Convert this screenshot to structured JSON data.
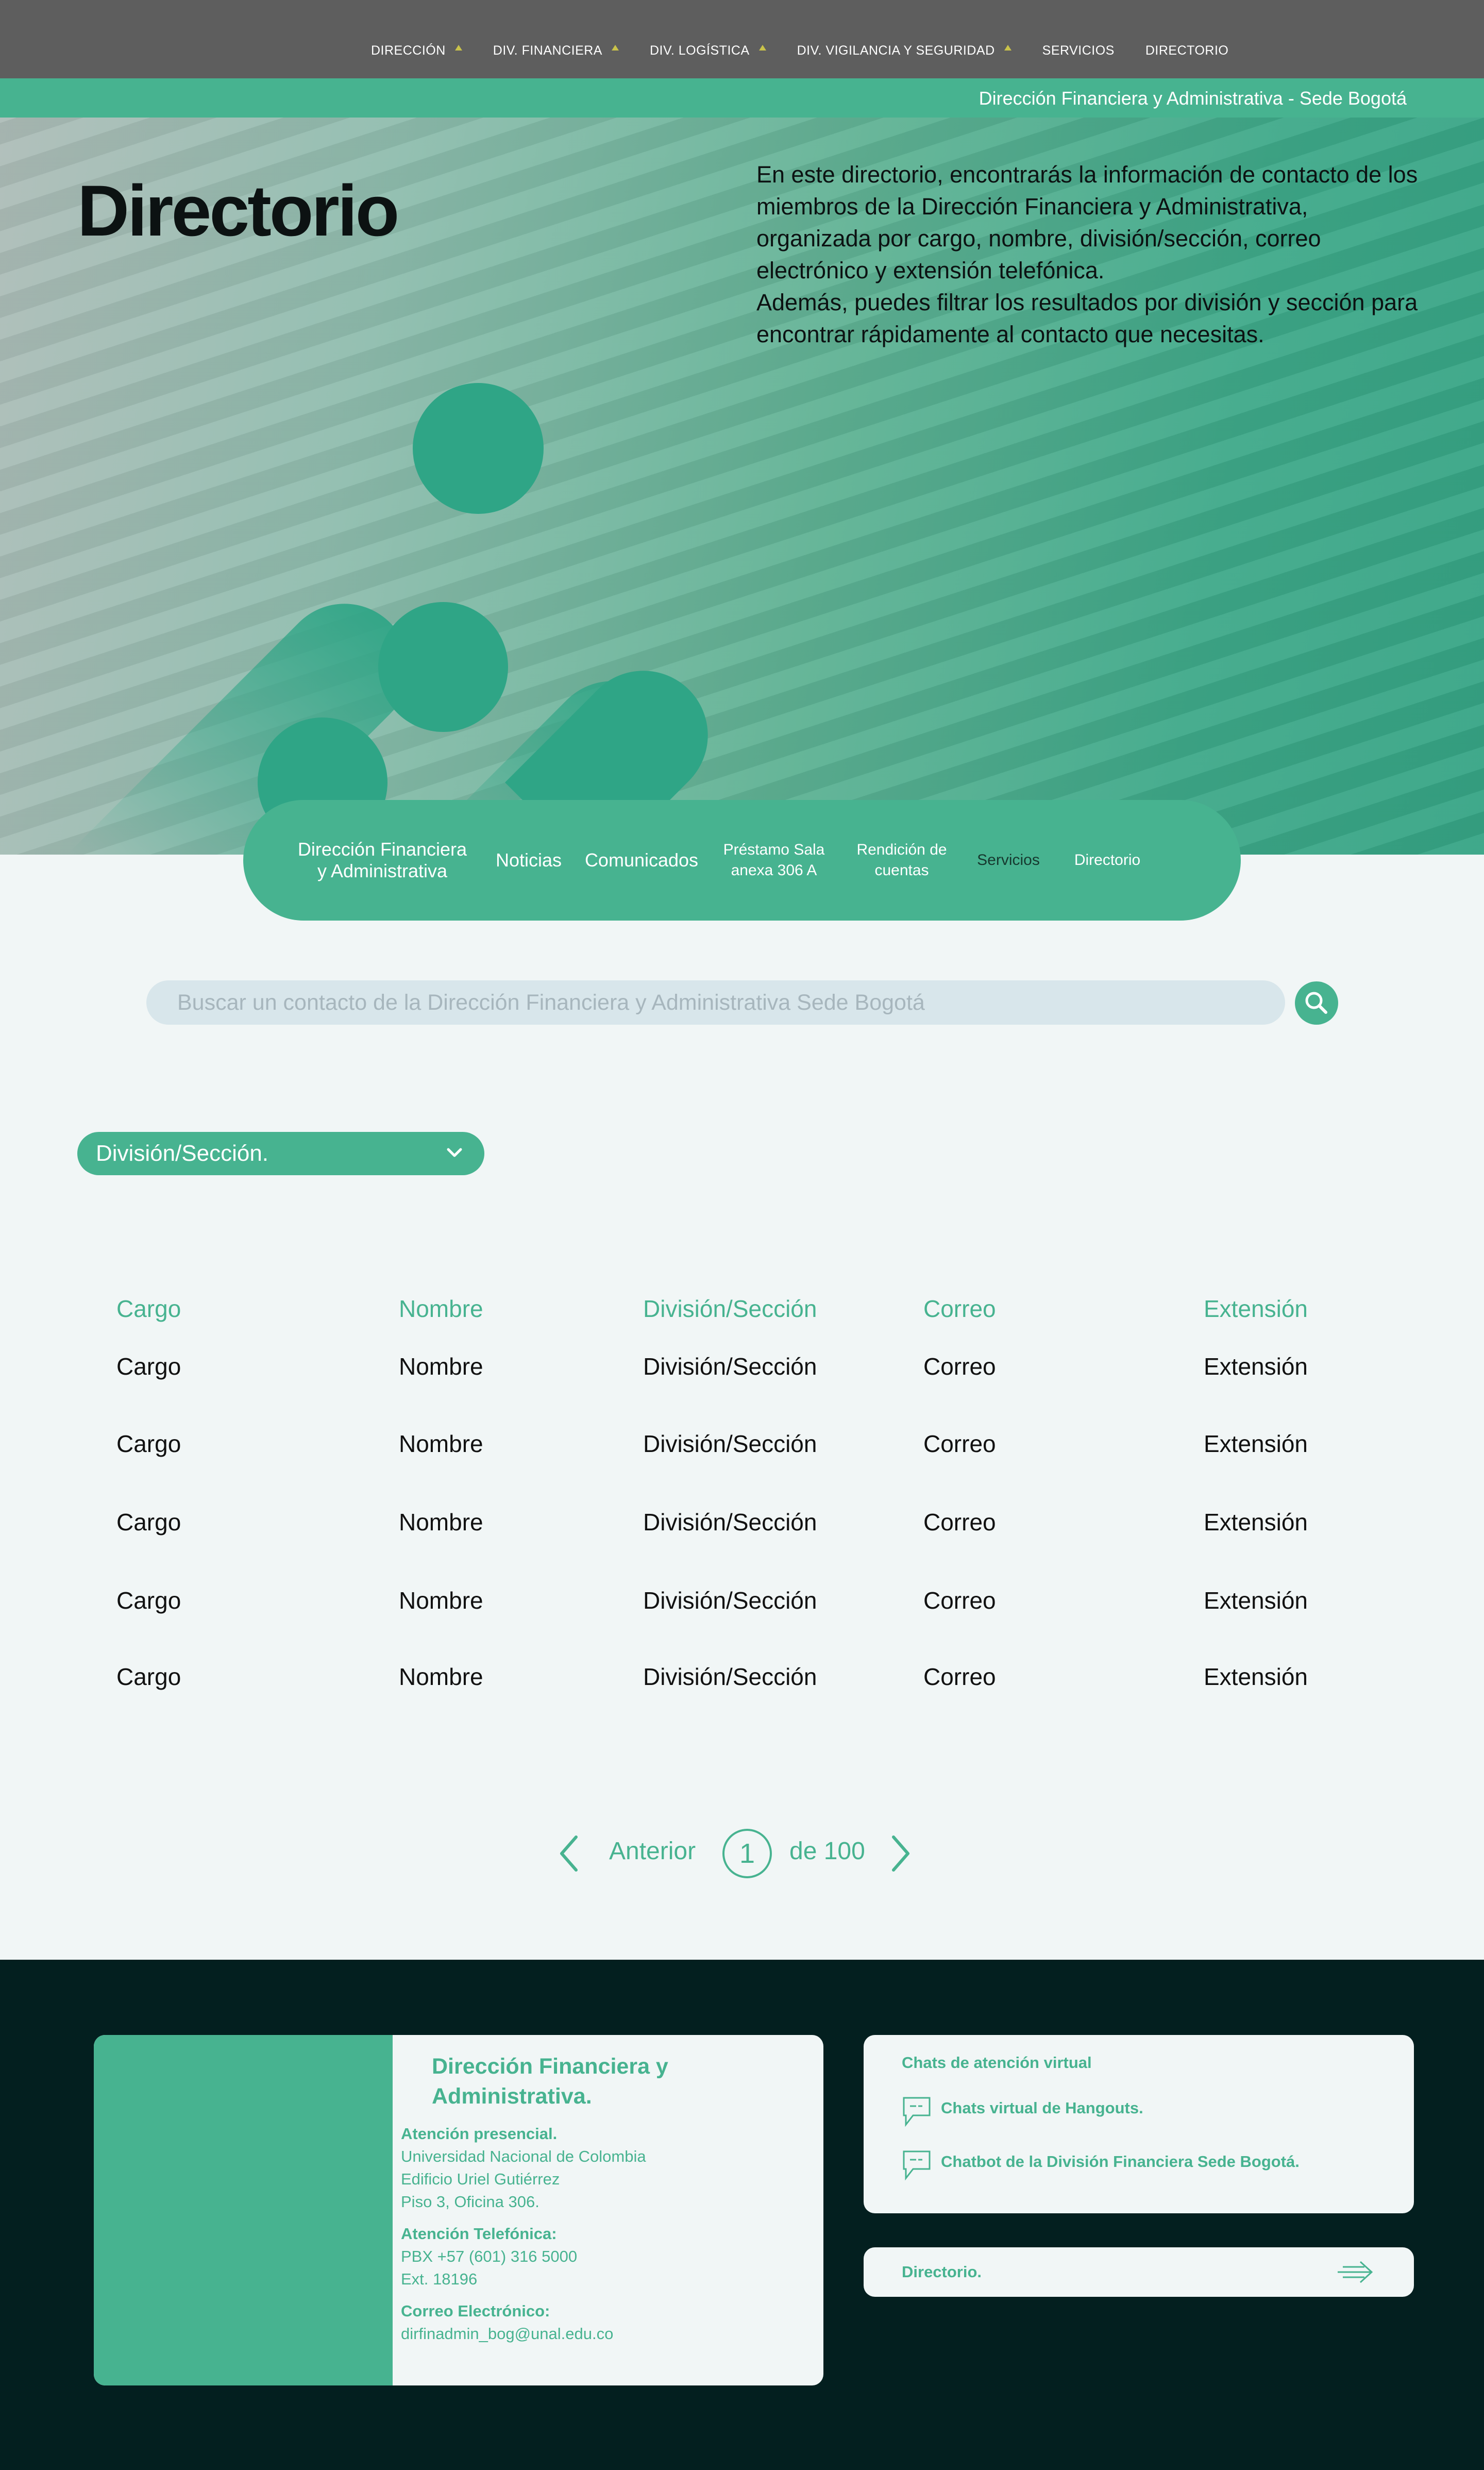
{
  "nav": {
    "items": [
      {
        "label": "DIRECCIÓN",
        "dropdown": true
      },
      {
        "label": "DIV. FINANCIERA",
        "dropdown": true
      },
      {
        "label": "DIV. LOGÍSTICA",
        "dropdown": true
      },
      {
        "label": "DIV. VIGILANCIA Y SEGURIDAD",
        "dropdown": true
      },
      {
        "label": "SERVICIOS",
        "dropdown": false
      },
      {
        "label": "DIRECTORIO",
        "dropdown": false
      }
    ]
  },
  "subbar": {
    "title": "Dirección Financiera y Administrativa - Sede Bogotá"
  },
  "hero": {
    "title": "Directorio",
    "description_1": "En este directorio, encontrarás la información de contacto de los miembros de la Dirección Financiera y Administrativa, organizada por cargo, nombre, división/sección, correo electrónico y extensión telefónica.",
    "description_2": "Además, puedes filtrar los resultados por división y sección para encontrar rápidamente al contacto que necesitas."
  },
  "tabs": [
    {
      "label": "Dirección Financiera y Administrativa"
    },
    {
      "label": "Noticias"
    },
    {
      "label": "Comunicados"
    },
    {
      "label": "Préstamo Sala anexa 306 A"
    },
    {
      "label": "Rendición de cuentas"
    },
    {
      "label": "Servicios",
      "active": true
    },
    {
      "label": "Directorio"
    }
  ],
  "search": {
    "placeholder": "Buscar un contacto de la Dirección Financiera y Administrativa Sede Bogotá",
    "icon": "search-icon"
  },
  "filter": {
    "label": "División/Sección.",
    "icon": "chevron-down-icon"
  },
  "table": {
    "headers": [
      "Cargo",
      "Nombre",
      "División/Sección",
      "Correo",
      "Extensión"
    ],
    "rows": [
      [
        "Cargo",
        "Nombre",
        "División/Sección",
        "Correo",
        "Extensión"
      ],
      [
        "Cargo",
        "Nombre",
        "División/Sección",
        "Correo",
        "Extensión"
      ],
      [
        "Cargo",
        "Nombre",
        "División/Sección",
        "Correo",
        "Extensión"
      ],
      [
        "Cargo",
        "Nombre",
        "División/Sección",
        "Correo",
        "Extensión"
      ],
      [
        "Cargo",
        "Nombre",
        "División/Sección",
        "Correo",
        "Extensión"
      ]
    ]
  },
  "pagination": {
    "prev_label": "Anterior",
    "current_page": "1",
    "total_label": "de 100"
  },
  "footer": {
    "contact_title": "Dirección Financiera y Administrativa.",
    "presencial_label": "Atención presencial.",
    "presencial_lines": [
      "Universidad Nacional de Colombia",
      "Edificio Uriel Gutiérrez",
      "Piso 3, Oficina 306."
    ],
    "telefono_label": "Atención Telefónica:",
    "telefono_lines": [
      "PBX +57 (601) 316 5000",
      "Ext. 18196"
    ],
    "correo_label": "Correo Electrónico:",
    "correo_value": "dirfinadmin_bog@unal.edu.co",
    "chats_title": "Chats de atención virtual",
    "chat_links": [
      "Chats virtual de Hangouts.",
      "Chatbot de la División  Financiera Sede Bogotá."
    ],
    "directorio_label": "Directorio."
  },
  "colors": {
    "accent": "#47b390",
    "dark": "#031f1f",
    "nav": "#5e5e5e",
    "caret": "#c9c24a"
  }
}
